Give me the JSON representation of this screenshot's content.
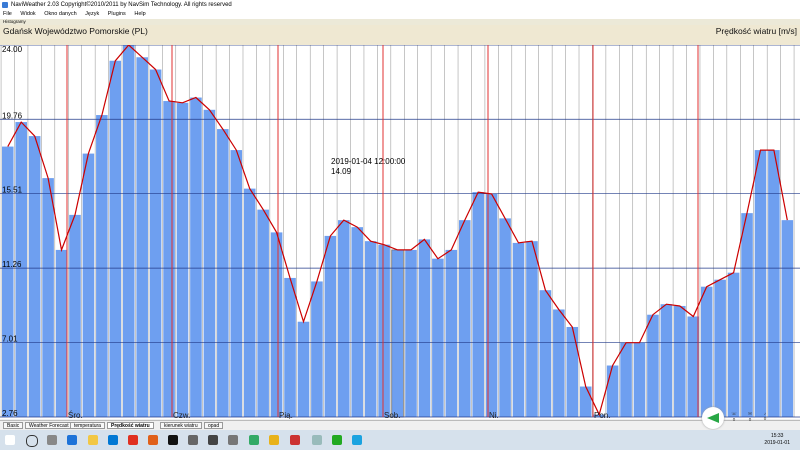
{
  "window": {
    "title": "NaviWeather 2.03 Copyright©2010/2011 by NavSim Technology. All rights reserved",
    "menu": [
      "File",
      "Widok",
      "Okno danych",
      "Język",
      "Plugins",
      "Help"
    ],
    "subheader": "Histogramy"
  },
  "chart_header": {
    "location": "Gdańsk Województwo Pomorskie (PL)",
    "parameter": "Prędkość wiatru [m/s]"
  },
  "tooltip": {
    "datetime": "2019-01-04 12:00:00",
    "value": "14.09"
  },
  "tabs": [
    "Basic",
    "Weather Forecast",
    "temperatura",
    "Prędkość wiatru",
    "kierunek wiatru",
    "opad"
  ],
  "active_tab": 3,
  "status_icons": [
    {
      "name": "phone-icon",
      "count": "0"
    },
    {
      "name": "chat-icon",
      "count": "0"
    },
    {
      "name": "bell-icon",
      "count": "0"
    }
  ],
  "taskbar": {
    "time": "15:33",
    "date": "2019-01-01"
  },
  "chart_data": {
    "type": "bar",
    "ylim": [
      2.76,
      24.0
    ],
    "y_ticks": [
      "24.00",
      "19.76",
      "15.51",
      "11.26",
      "7.01",
      "2.76"
    ],
    "day_labels": [
      "Śro.",
      "Czw.",
      "Pią.",
      "Sob.",
      "Ni.",
      "Pon."
    ],
    "highlight_index": 29,
    "colors": {
      "bar": "#6e9ff0",
      "line": "#cc0000",
      "day_line": "#e23030",
      "grid": "#333333"
    },
    "values": [
      18.2,
      19.6,
      18.8,
      16.4,
      12.3,
      14.3,
      17.8,
      20.0,
      23.1,
      24.0,
      23.3,
      22.6,
      20.8,
      20.7,
      21.0,
      20.3,
      19.2,
      18.0,
      15.8,
      14.6,
      13.3,
      10.7,
      8.2,
      10.5,
      13.1,
      14.0,
      13.6,
      12.8,
      12.6,
      12.3,
      12.3,
      12.9,
      11.8,
      12.3,
      14.0,
      15.6,
      15.5,
      14.1,
      12.7,
      12.8,
      10.0,
      8.9,
      7.9,
      4.5,
      2.9,
      5.7,
      7.0,
      7.0,
      8.6,
      9.2,
      9.1,
      8.5,
      10.2,
      10.6,
      11.0,
      14.4,
      18.0,
      18.0,
      14.0
    ]
  }
}
